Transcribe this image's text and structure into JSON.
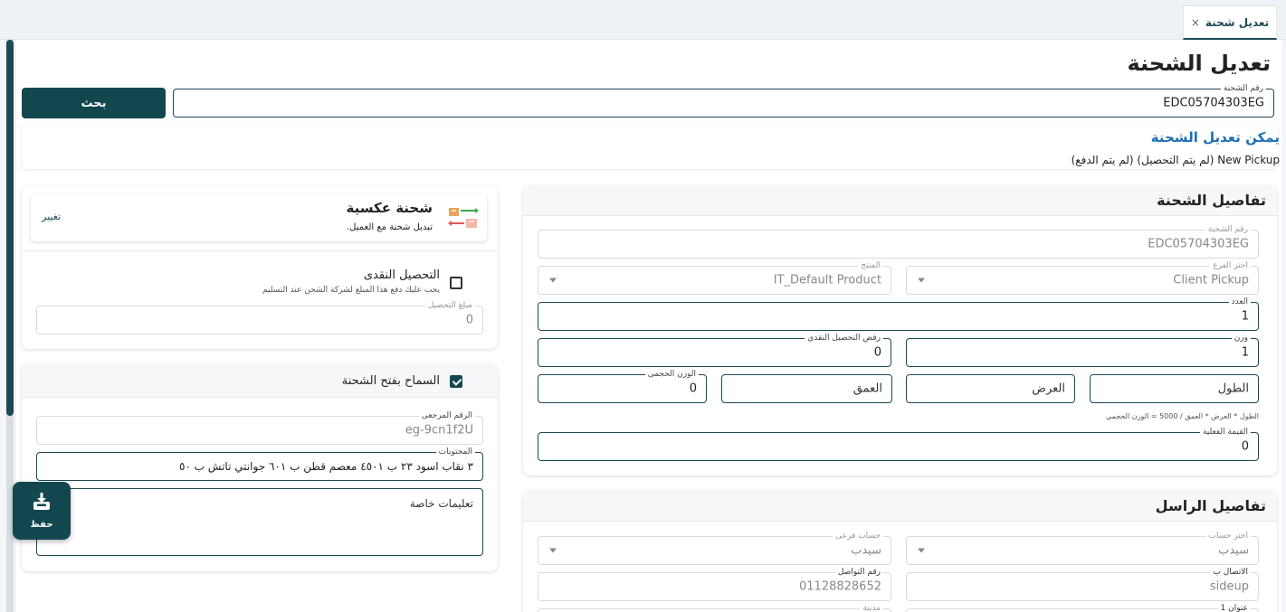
{
  "tab": {
    "label": "تعديل شحنة",
    "close": "×"
  },
  "page": {
    "title": "تعديل الشحنة"
  },
  "search": {
    "label": "رقم الشحنة",
    "value": "EDC05704303EG",
    "button": "بحث"
  },
  "info": {
    "title": "يمكن تعديل الشحنة",
    "status": "New Pickup (لم يتم التحصيل) (لم يتم الدفع)"
  },
  "details": {
    "title": "تفاصيل الشحنة",
    "shipment_no": {
      "label": "رقم الشحنة",
      "value": "EDC05704303EG"
    },
    "branch": {
      "label": "اختر الفرع",
      "value": "Client Pickup"
    },
    "product": {
      "label": "المنتج",
      "value": "IT_Default Product"
    },
    "count": {
      "label": "العدد",
      "value": "1"
    },
    "weight": {
      "label": "وزن",
      "value": "1"
    },
    "cod_reject": {
      "label": "رفض التحصيل النقدى",
      "value": "0"
    },
    "length": {
      "placeholder": "الطول"
    },
    "width": {
      "placeholder": "العرض"
    },
    "depth": {
      "placeholder": "العمق"
    },
    "volumetric": {
      "label": "الوزن الحجمى",
      "value": "0"
    },
    "formula": "الطول * العرض * العمق / 5000 = الوزن الحجمي",
    "actual_value": {
      "label": "القيمة الفعلية",
      "value": "0"
    }
  },
  "sender": {
    "title": "تفاصيل الراسل",
    "account": {
      "label": "اختر حساب",
      "value": "سيدب"
    },
    "sub_account": {
      "label": "حساب فرعى",
      "value": "سيدب"
    },
    "contact": {
      "label": "الاتصال ب",
      "value": "sideup"
    },
    "phone": {
      "label": "رقم التواصل",
      "value": "01128828652"
    },
    "address": {
      "label": "عنوان 1"
    },
    "city": {
      "label": "مدينة"
    }
  },
  "reverse": {
    "title": "شحنة عكسية",
    "subtitle": "تبديل شحنة مع العميل.",
    "change": "تغيير"
  },
  "cod": {
    "label": "التحصيل النقدى",
    "hint": "يجب عليك دفع هذا المبلغ لشركة الشحن عند التسليم",
    "amount_label": "مبلغ التحصيل",
    "amount_value": "0"
  },
  "open": {
    "label": "السماح بفتح الشحنة",
    "reference": {
      "label": "الرقم المرجعى",
      "value": "eg-9cn1f2U"
    },
    "contents": {
      "label": "المحتويات",
      "value": "٣ نقاب اسود ٢٣ ب ٤٥٠١ معصم قطن ب ٦٠١ جوانتي تاتش ب ٥٠"
    },
    "instructions": {
      "placeholder": "تعليمات خاصة"
    }
  },
  "fab": {
    "label": "حفظ",
    "icon": "save-tray-icon"
  },
  "colors": {
    "primary": "#13474f",
    "link": "#1f6fb5"
  }
}
